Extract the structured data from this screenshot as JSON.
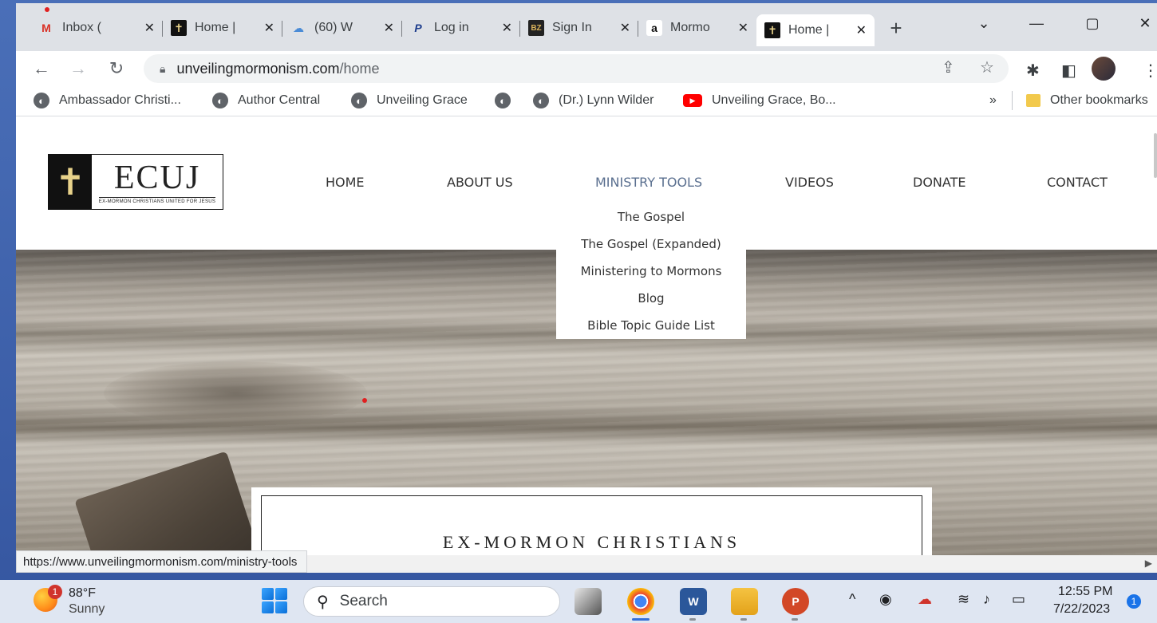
{
  "tabs": [
    {
      "title": "Inbox (",
      "favicon": "gmail-icon",
      "active": false
    },
    {
      "title": "Home |",
      "favicon": "cross-favicon-icon",
      "active": false
    },
    {
      "title": "(60) W",
      "favicon": "cloud-favicon-icon",
      "active": false
    },
    {
      "title": "Log in",
      "favicon": "paypal-icon",
      "active": false
    },
    {
      "title": "Sign In",
      "favicon": "bz-favicon-icon",
      "active": false
    },
    {
      "title": "Mormo",
      "favicon": "amazon-icon",
      "active": false
    },
    {
      "title": "Home |",
      "favicon": "cross-favicon-icon",
      "active": true
    }
  ],
  "address": {
    "host": "unveilingmormonism.com",
    "path": "/home"
  },
  "bookmarks": [
    "Ambassador Christi...",
    "Author Central",
    "Unveiling Grace",
    "",
    "(Dr.) Lynn Wilder",
    "Unveiling Grace, Bo..."
  ],
  "bookmarks_overflow": "»",
  "other_bookmarks": "Other bookmarks",
  "logo": {
    "wordmark": "ECUJ",
    "tagline": "EX-MORMON CHRISTIANS UNITED FOR JESUS"
  },
  "nav": [
    "HOME",
    "ABOUT US",
    "MINISTRY TOOLS",
    "VIDEOS",
    "DONATE",
    "CONTACT"
  ],
  "dropdown": [
    "The Gospel",
    "The Gospel (Expanded)",
    "Ministering to Mormons",
    "Blog",
    "Bible Topic Guide List"
  ],
  "hero_caption": "EX-MORMON CHRISTIANS",
  "status_url": "https://www.unveilingmormonism.com/ministry-tools",
  "taskbar": {
    "temp": "88°F",
    "condition": "Sunny",
    "weather_badge": "1",
    "search": "Search",
    "time": "12:55 PM",
    "date": "7/22/2023",
    "notif_badge": "1"
  },
  "colors": {
    "nav_active": "#5a6f8f",
    "tab_bg": "#dee1e6",
    "taskbar_bg": "#dfe6f2"
  }
}
